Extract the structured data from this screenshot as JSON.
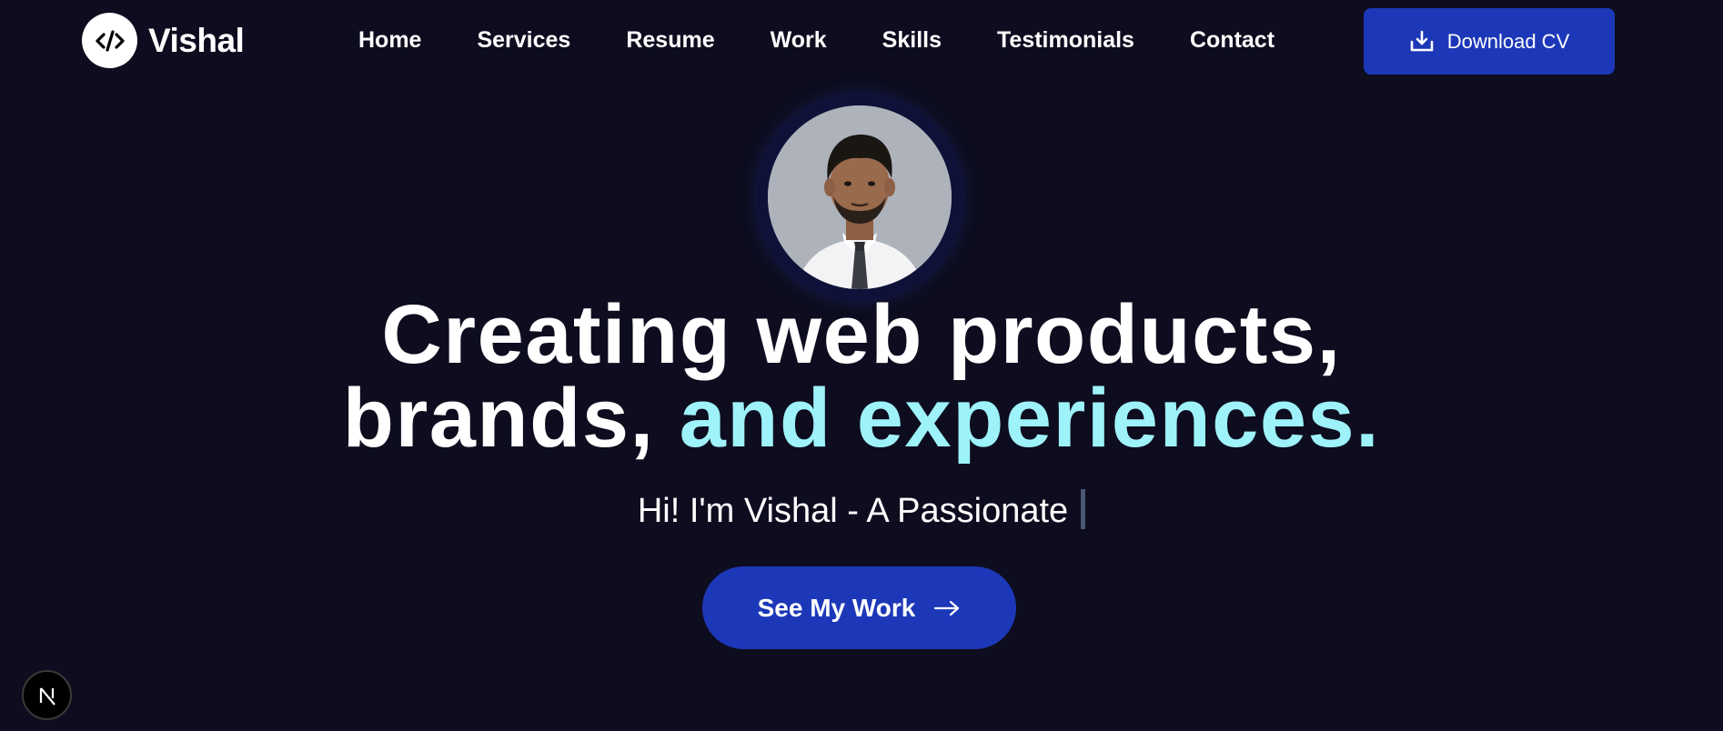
{
  "brand": {
    "name": "Vishal",
    "logo_icon": "code-icon"
  },
  "nav": {
    "items": [
      {
        "label": "Home"
      },
      {
        "label": "Services"
      },
      {
        "label": "Resume"
      },
      {
        "label": "Work"
      },
      {
        "label": "Skills"
      },
      {
        "label": "Testimonials"
      },
      {
        "label": "Contact"
      }
    ]
  },
  "header": {
    "cv_button_label": "Download CV",
    "cv_icon": "download-icon"
  },
  "hero": {
    "avatar_icon": "profile-photo",
    "headline_line1": "Creating web products,",
    "headline_line2_white": "brands, ",
    "headline_line2_accent": "and experiences.",
    "subline": "Hi! I'm Vishal - A Passionate",
    "cta_label": "See My Work",
    "cta_icon": "arrow-right-icon"
  },
  "badge": {
    "label": "N"
  },
  "colors": {
    "background": "#0d0d1f",
    "accent": "#9ef2f9",
    "button": "#1c38b8"
  }
}
